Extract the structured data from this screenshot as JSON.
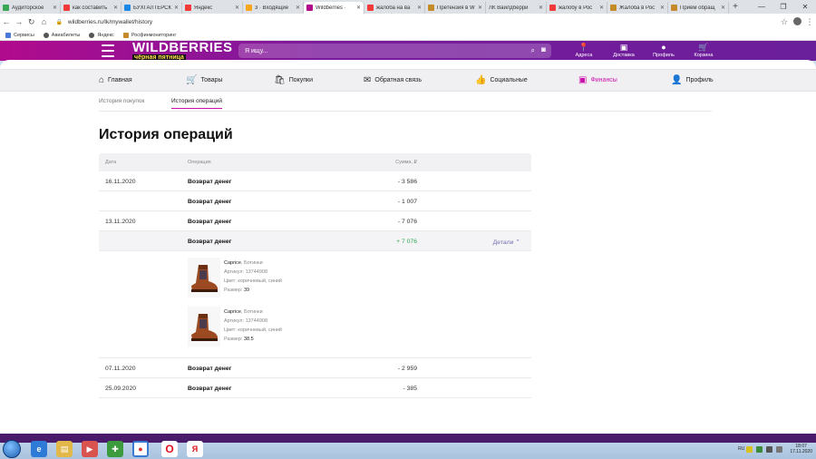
{
  "browser": {
    "tabs": [
      {
        "title": "Аудиторское",
        "color": "#3aa757"
      },
      {
        "title": "как составить",
        "color": "#f23a3a"
      },
      {
        "title": "БУХГАЛТЕРСК",
        "color": "#1e88e5"
      },
      {
        "title": "Яндекс",
        "color": "#f23a3a"
      },
      {
        "title": "3 · Входящие",
        "color": "#f7a51c"
      },
      {
        "title": "Wildberries · ",
        "color": "#b10a8d",
        "active": true
      },
      {
        "title": "жалоба на ва",
        "color": "#f23a3a"
      },
      {
        "title": "Претензия в W",
        "color": "#c58b2a"
      },
      {
        "title": "ЛК Вайлдберри",
        "color": "#555555",
        "prefix": "ЛК"
      },
      {
        "title": "жалобу в Рос",
        "color": "#f23a3a"
      },
      {
        "title": "Жалоба в Рос",
        "color": "#c58b2a"
      },
      {
        "title": "Приём обращ",
        "color": "#c58b2a"
      }
    ],
    "url": "wildberries.ru/lk/mywallet/history",
    "bookmarks": [
      {
        "label": "Сервисы",
        "color": "#4a7ad8"
      },
      {
        "label": "Авиабилеты",
        "color": "#555555"
      },
      {
        "label": "Яндекс",
        "color": "#555555"
      },
      {
        "label": "Росфинмониторинг",
        "color": "#c58b2a"
      }
    ]
  },
  "header": {
    "logo": "WILDBERRIES",
    "promo": "чёрная пятница",
    "search_placeholder": "Я ищу...",
    "icons": [
      {
        "label": "Адреса",
        "glyph": "⬤"
      },
      {
        "label": "Доставка",
        "glyph": "▣"
      },
      {
        "label": "Профиль",
        "glyph": "●"
      },
      {
        "label": "Корзина",
        "glyph": "🛒"
      }
    ]
  },
  "nav": [
    {
      "label": "Главная",
      "glyph": "⌂"
    },
    {
      "label": "Товары",
      "glyph": "🛒"
    },
    {
      "label": "Покупки",
      "glyph": "🛍"
    },
    {
      "label": "Обратная связь",
      "glyph": "✉"
    },
    {
      "label": "Социальные",
      "glyph": "👍"
    },
    {
      "label": "Финансы",
      "glyph": "▣",
      "active": true
    },
    {
      "label": "Профиль",
      "glyph": "👤"
    }
  ],
  "subtabs": {
    "purchases": "История покупок",
    "operations": "История операций"
  },
  "page_title": "История операций",
  "table": {
    "col_date": "Дата",
    "col_op": "Операция",
    "col_sum": "Сумма, ₽",
    "details_label": "Детали",
    "rows": [
      {
        "date": "16.11.2020",
        "op": "Возврат денег",
        "amount": "- 3 586"
      },
      {
        "date": "",
        "op": "Возврат денег",
        "amount": "- 1 007"
      },
      {
        "date": "13.11.2020",
        "op": "Возврат денег",
        "amount": "- 7 076"
      },
      {
        "date": "",
        "op": "Возврат денег",
        "amount": "+ 7 076"
      }
    ],
    "rows_after": [
      {
        "date": "07.11.2020",
        "op": "Возврат денег",
        "amount": "- 2 959"
      },
      {
        "date": "25.09.2020",
        "op": "Возврат денег",
        "amount": "- 385"
      }
    ],
    "items": [
      {
        "brand": "Caprice",
        "type": ", Ботинки",
        "article_label": "Артикул: ",
        "article": "13744908",
        "color": "Цвет: коричневый, синий",
        "size_label": "Размер: ",
        "size": "39"
      },
      {
        "brand": "Caprice",
        "type": ", Ботинки",
        "article_label": "Артикул: ",
        "article": "13744908",
        "color": "Цвет: коричневый, синий",
        "size_label": "Размер: ",
        "size": "38.5"
      }
    ]
  },
  "taskbar": {
    "lang": "RU",
    "time": "18:07",
    "date": "17.11.2020"
  },
  "colors": {
    "brand": "#cb11ab",
    "positive": "#34a853",
    "link": "#6f6fb2"
  }
}
